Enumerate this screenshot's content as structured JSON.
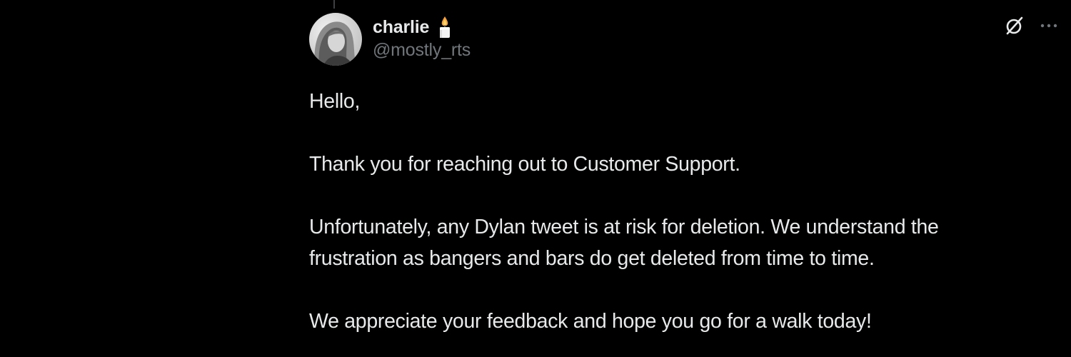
{
  "tweet": {
    "author": {
      "display_name": "charlie",
      "handle": "@mostly_rts",
      "badge_icon": "candle-icon",
      "avatar": "avatar-photo"
    },
    "actions": {
      "grok_icon": "grok-icon",
      "more_icon": "more-icon"
    },
    "body": {
      "line1": "Hello,",
      "line2": "Thank you for reaching out to Customer Support.",
      "line3": "Unfortunately, any Dylan tweet is at risk for deletion. We understand the",
      "line4": "frustration as bangers and bars do get deleted from time to time.",
      "line5": "We appreciate your feedback and hope you go for a walk today!"
    }
  },
  "colors": {
    "background": "#000000",
    "primary_text": "#e7e9ea",
    "secondary_text": "#71767b",
    "thread_line": "#3e4144"
  }
}
